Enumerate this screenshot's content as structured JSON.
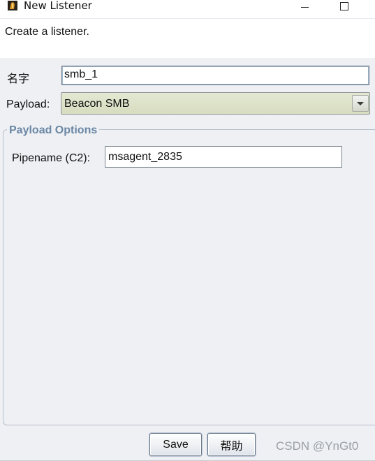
{
  "window": {
    "title": "New Listener",
    "icon": "cobalt-strike-app-icon"
  },
  "description": "Create a listener.",
  "form": {
    "name_label": "名字",
    "name_value": "smb_1",
    "payload_label": "Payload:",
    "payload_value": "Beacon SMB"
  },
  "payload_options": {
    "title": "Payload Options",
    "pipename_label": "Pipename (C2):",
    "pipename_value": "msagent_2835"
  },
  "buttons": {
    "save": "Save",
    "help": "帮助"
  },
  "watermark": "CSDN @YnGt0",
  "colors": {
    "group_title": "#6b87a4",
    "select_bg": "#dde2c8",
    "panel_bg": "#eef0f4"
  }
}
